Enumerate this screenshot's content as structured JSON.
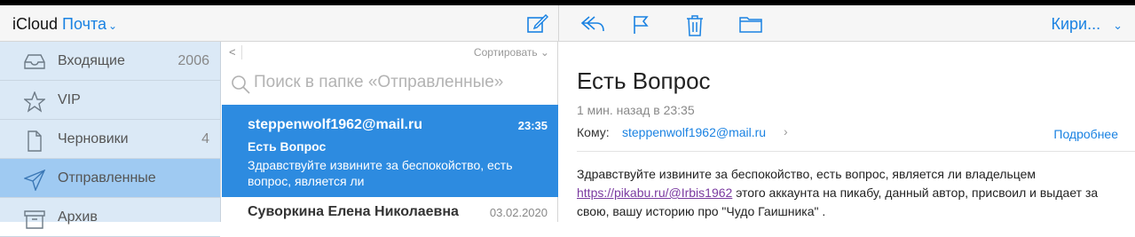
{
  "header": {
    "brand": "iCloud",
    "app_name": "Почта",
    "user_menu": "Кири..."
  },
  "toolbar": {
    "icons": [
      "reply-icon",
      "flag-icon",
      "trash-icon",
      "folder-icon"
    ]
  },
  "sidebar": {
    "items": [
      {
        "label": "Входящие",
        "count": "2006",
        "icon": "inbox-icon"
      },
      {
        "label": "VIP",
        "count": "",
        "icon": "star-icon"
      },
      {
        "label": "Черновики",
        "count": "4",
        "icon": "document-icon"
      },
      {
        "label": "Отправленные",
        "count": "",
        "icon": "paper-plane-icon",
        "active": true
      },
      {
        "label": "Архив",
        "count": "",
        "icon": "archive-icon"
      }
    ]
  },
  "list": {
    "back": "<",
    "sort_label": "Сортировать ⌄",
    "search_placeholder": "Поиск в папке «Отправленные»",
    "messages": [
      {
        "from": "steppenwolf1962@mail.ru",
        "date": "23:35",
        "subject": "Есть Вопрос",
        "preview": "Здравствуйте извините за беспокойство, есть вопрос, является ли",
        "selected": true
      },
      {
        "from": "Суворкина Елена Николаевна",
        "date": "03.02.2020",
        "subject": "",
        "preview": "",
        "selected": false
      }
    ]
  },
  "reader": {
    "subject": "Есть Вопрос",
    "time": "1 мин. назад в 23:35",
    "to_label": "Кому:",
    "to_address": "steppenwolf1962@mail.ru",
    "details_label": "Подробнее",
    "body_part1": "Здравствуйте извините за беспокойство, есть вопрос, является ли владельцем ",
    "body_link": "https://pikabu.ru/@Irbis1962",
    "body_part2": " этого аккаунта на пикабу, данный автор, присвоил и выдает за свою,  вашу историю про \"Чудо Гаишника\" ."
  },
  "colors": {
    "accent": "#1a82e2",
    "sidebar_bg": "#dbe9f6",
    "sidebar_active": "#9fcaf2",
    "selected_msg": "#2d8be0",
    "link_visited": "#7a3aa0"
  }
}
